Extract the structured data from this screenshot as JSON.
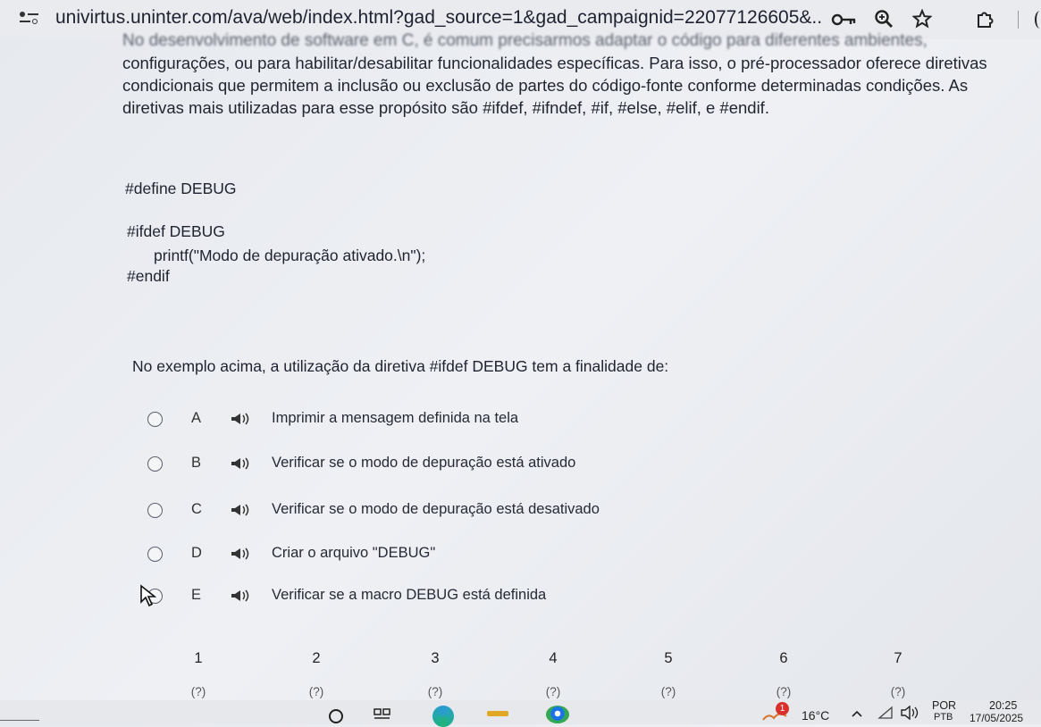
{
  "browser": {
    "url": "univirtus.uninter.com/ava/web/index.html?gad_source=1&gad_campaignid=22077126605&..."
  },
  "content": {
    "cut_line": "No desenvolvimento de software em C, é comum precisarmos adaptar o código para diferentes ambientes,",
    "paragraph": "configurações, ou para habilitar/desabilitar funcionalidades específicas. Para isso, o pré-processador oferece diretivas condicionais que permitem a inclusão ou exclusão de partes do código-fonte conforme determinadas condições. As diretivas mais utilizadas para esse propósito são #ifdef, #ifndef, #if, #else, #elif, e #endif.",
    "code": {
      "line1": "#define DEBUG",
      "line2": "#ifdef DEBUG",
      "line3": "printf(\"Modo de depuração ativado.\\n\");",
      "line4": "#endif"
    },
    "question": "No exemplo acima, a utilização da diretiva #ifdef DEBUG tem a finalidade de:",
    "options": [
      {
        "letter": "A",
        "text": "Imprimir a mensagem definida na tela"
      },
      {
        "letter": "B",
        "text": "Verificar se o modo de depuração está ativado"
      },
      {
        "letter": "C",
        "text": "Verificar se o modo de depuração está desativado"
      },
      {
        "letter": "D",
        "text": "Criar o arquivo \"DEBUG\""
      },
      {
        "letter": "E",
        "text": "Verificar se a macro DEBUG está definida"
      }
    ],
    "question_nav": [
      {
        "num": "1",
        "status": "(?)"
      },
      {
        "num": "2",
        "status": "(?)"
      },
      {
        "num": "3",
        "status": "(?)"
      },
      {
        "num": "4",
        "status": "(?)"
      },
      {
        "num": "5",
        "status": "(?)"
      },
      {
        "num": "6",
        "status": "(?)"
      },
      {
        "num": "7",
        "status": "(?)"
      }
    ]
  },
  "taskbar": {
    "weather": "16°C",
    "language": "POR",
    "layout": "PTB",
    "time": "20:25",
    "date": "17/05/2025",
    "notification_count": "1"
  }
}
